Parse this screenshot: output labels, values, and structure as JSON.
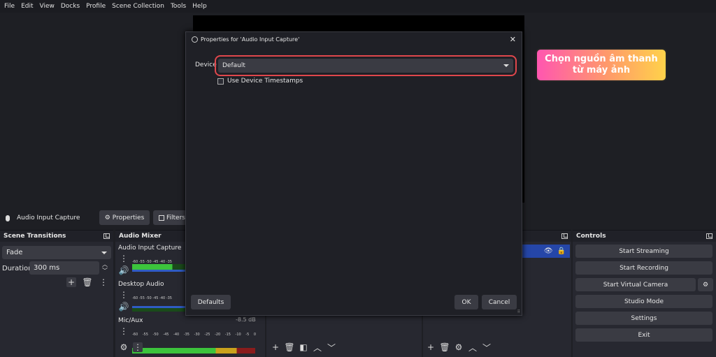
{
  "menu": [
    "File",
    "Edit",
    "View",
    "Docks",
    "Profile",
    "Scene Collection",
    "Tools",
    "Help"
  ],
  "note": {
    "text": "Chọn nguồn âm thanh từ máy ảnh"
  },
  "source_bar": {
    "name": "Audio Input Capture",
    "properties": "Properties",
    "filters": "Filters"
  },
  "transitions": {
    "title": "Scene Transitions",
    "selected": "Fade",
    "duration_label": "Duration",
    "duration_value": "300 ms"
  },
  "mixer": {
    "title": "Audio Mixer",
    "channels": [
      {
        "name": "Audio Input Capture",
        "level": 0.55
      },
      {
        "name": "Desktop Audio",
        "level": 0.55
      },
      {
        "name": "Mic/Aux",
        "level": 0.95,
        "db": "-8.5 dB"
      }
    ],
    "ticks": [
      "-60",
      "-55",
      "-50",
      "-45",
      "-40",
      "-35",
      "-30",
      "-25",
      "-20",
      "-15",
      "-10",
      "-5",
      "0"
    ]
  },
  "controls": {
    "title": "Controls",
    "buttons": [
      "Start Streaming",
      "Start Recording",
      "Start Virtual Camera",
      "Studio Mode",
      "Settings",
      "Exit"
    ]
  },
  "dialog": {
    "title": "Properties for 'Audio Input Capture'",
    "device_label": "Device",
    "device_value": "Default",
    "checkbox_label": "Use Device Timestamps",
    "defaults": "Defaults",
    "ok": "OK",
    "cancel": "Cancel"
  },
  "colors": {
    "highlight": "#e0474c",
    "selected_row": "#2546a8"
  }
}
